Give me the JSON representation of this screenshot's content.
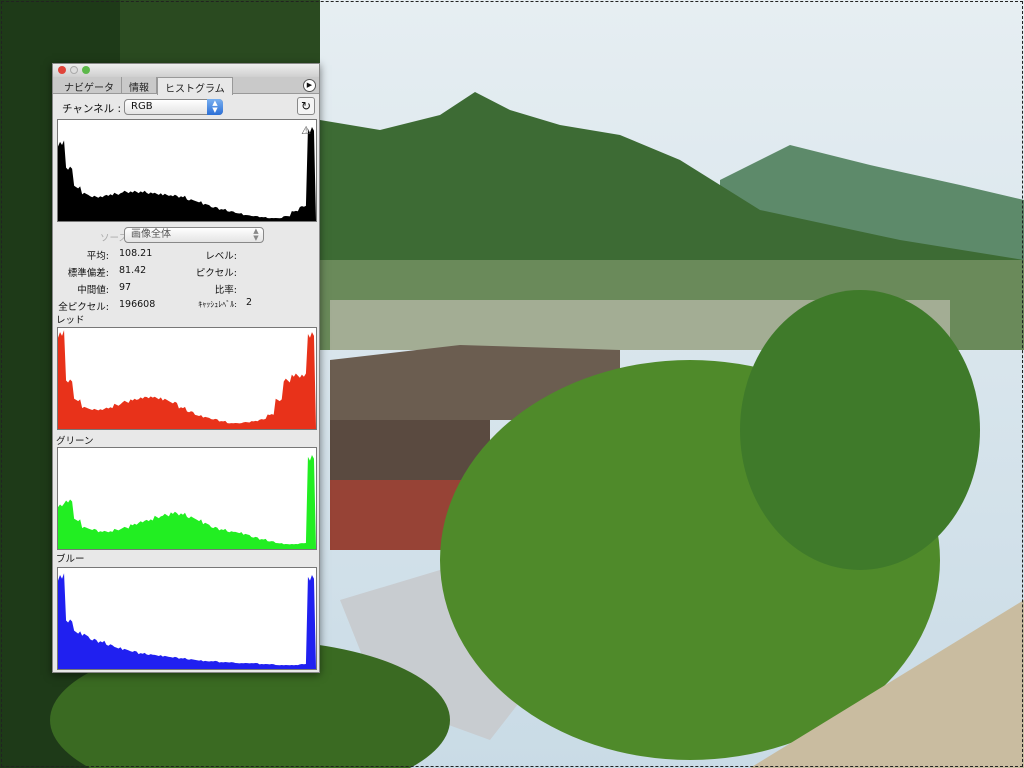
{
  "panel": {
    "tabs": [
      "ナビゲータ",
      "情報",
      "ヒストグラム"
    ],
    "active_tab": 2,
    "channel_label": "チャンネル :",
    "channel_value": "RGB",
    "source_label": "ソース :",
    "source_value": "画像全体",
    "stats": {
      "mean_label": "平均:",
      "mean": "108.21",
      "stddev_label": "標準偏差:",
      "stddev": "81.42",
      "median_label": "中間値:",
      "median": "97",
      "pixels_label": "全ピクセル:",
      "pixels": "196608",
      "level_label": "レベル:",
      "count_label": "ピクセル:",
      "percentile_label": "比率:",
      "cache_label": "ｷｬｯｼｭﾚﾍﾞﾙ:",
      "cache": "2"
    },
    "channel_titles": {
      "red": "レッド",
      "green": "グリーン",
      "blue": "ブルー"
    },
    "warning_icon": "⚠",
    "refresh_icon": "↻"
  },
  "chart_data": [
    {
      "type": "area",
      "title": "RGB",
      "color": "#000000",
      "xlim": [
        0,
        255
      ],
      "ylim": [
        0,
        1
      ],
      "values": [
        0.8,
        0.55,
        0.35,
        0.28,
        0.25,
        0.25,
        0.27,
        0.28,
        0.3,
        0.3,
        0.3,
        0.29,
        0.28,
        0.27,
        0.26,
        0.25,
        0.22,
        0.2,
        0.17,
        0.14,
        0.12,
        0.1,
        0.08,
        0.06,
        0.05,
        0.04,
        0.03,
        0.03,
        0.05,
        0.1,
        0.15,
        0.95
      ]
    },
    {
      "type": "area",
      "title": "レッド",
      "color": "#e8321a",
      "xlim": [
        0,
        255
      ],
      "ylim": [
        0,
        1
      ],
      "values": [
        0.98,
        0.5,
        0.3,
        0.22,
        0.2,
        0.2,
        0.22,
        0.25,
        0.28,
        0.3,
        0.32,
        0.33,
        0.32,
        0.3,
        0.27,
        0.22,
        0.18,
        0.14,
        0.12,
        0.1,
        0.08,
        0.06,
        0.06,
        0.07,
        0.08,
        0.1,
        0.15,
        0.3,
        0.5,
        0.55,
        0.55,
        0.98
      ]
    },
    {
      "type": "area",
      "title": "グリーン",
      "color": "#22ee22",
      "xlim": [
        0,
        255
      ],
      "ylim": [
        0,
        1
      ],
      "values": [
        0.45,
        0.5,
        0.3,
        0.22,
        0.2,
        0.18,
        0.18,
        0.2,
        0.22,
        0.25,
        0.28,
        0.3,
        0.33,
        0.35,
        0.37,
        0.36,
        0.33,
        0.3,
        0.26,
        0.22,
        0.2,
        0.18,
        0.17,
        0.15,
        0.12,
        0.1,
        0.08,
        0.06,
        0.05,
        0.05,
        0.06,
        0.95
      ]
    },
    {
      "type": "area",
      "title": "ブルー",
      "color": "#2020f0",
      "xlim": [
        0,
        255
      ],
      "ylim": [
        0,
        1
      ],
      "values": [
        0.95,
        0.5,
        0.38,
        0.35,
        0.3,
        0.28,
        0.25,
        0.22,
        0.2,
        0.18,
        0.16,
        0.15,
        0.14,
        0.13,
        0.12,
        0.11,
        0.1,
        0.09,
        0.08,
        0.08,
        0.07,
        0.07,
        0.06,
        0.06,
        0.06,
        0.05,
        0.05,
        0.04,
        0.04,
        0.04,
        0.05,
        0.95
      ]
    }
  ]
}
